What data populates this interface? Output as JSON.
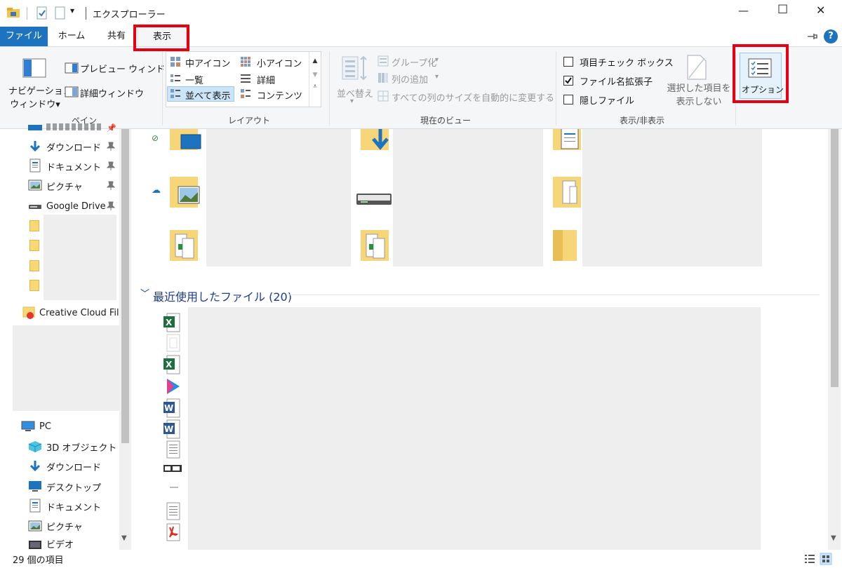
{
  "window": {
    "title": "エクスプローラー",
    "controls": {
      "minimize": "—",
      "maximize": "☐",
      "close": "✕"
    }
  },
  "tabs": [
    {
      "label": "ファイル",
      "active": false,
      "primary": true
    },
    {
      "label": "ホーム",
      "active": false
    },
    {
      "label": "共有",
      "active": false
    },
    {
      "label": "表示",
      "active": true
    }
  ],
  "ribbon": {
    "pane": {
      "navigation_pane": [
        "ナビゲーション",
        "ウィンドウ▾"
      ],
      "preview_pane": "プレビュー ウィンドウ",
      "details_pane": "詳細ウィンドウ",
      "label": "ペイン"
    },
    "layout": {
      "items": [
        "中アイコン",
        "小アイコン",
        "一覧",
        "詳細",
        "並べて表示",
        "コンテンツ"
      ],
      "selected": "並べて表示",
      "label": "レイアウト"
    },
    "current_view": {
      "sort": "並べ替え",
      "group_by": "グループ化",
      "add_columns": "列の追加",
      "size_all_columns": "すべての列のサイズを自動的に変更する",
      "label": "現在のビュー"
    },
    "show_hide": {
      "item_checkboxes": "項目チェック ボックス",
      "file_extensions": "ファイル名拡張子",
      "hidden_items": "隠しファイル",
      "hide_selected": [
        "選択した項目を",
        "表示しない"
      ],
      "label": "表示/非表示",
      "states": {
        "item_checkboxes": false,
        "file_extensions": true,
        "hidden_items": false
      }
    },
    "options": {
      "label": "オプション"
    }
  },
  "nav": {
    "quick_access": [
      {
        "label": "ダウンロード",
        "icon": "download-arrow-icon",
        "pinned": true
      },
      {
        "label": "ドキュメント",
        "icon": "document-icon",
        "pinned": true
      },
      {
        "label": "ピクチャ",
        "icon": "pictures-icon",
        "pinned": true
      },
      {
        "label": "Google Drive",
        "icon": "drive-icon",
        "pinned": true
      }
    ],
    "creative_cloud": "Creative Cloud File",
    "pc": {
      "label": "PC",
      "items": [
        {
          "label": "3D オブジェクト",
          "icon": "cube-icon"
        },
        {
          "label": "ダウンロード",
          "icon": "download-arrow-icon"
        },
        {
          "label": "デスクトップ",
          "icon": "desktop-icon"
        },
        {
          "label": "ドキュメント",
          "icon": "document-icon"
        },
        {
          "label": "ピクチャ",
          "icon": "pictures-icon"
        },
        {
          "label": "ビデオ",
          "icon": "video-icon"
        }
      ]
    }
  },
  "content": {
    "recent_header": "最近使用したファイル (20)"
  },
  "status": {
    "item_count": "29 個の項目"
  },
  "colors": {
    "file_tab": "#1e73be",
    "highlight_red": "#e60012",
    "ribbon_bg": "#f5f6f7",
    "selected_bg": "#cce4f7",
    "selected_border": "#99c9ef",
    "group_header": "#1e3c8c"
  }
}
